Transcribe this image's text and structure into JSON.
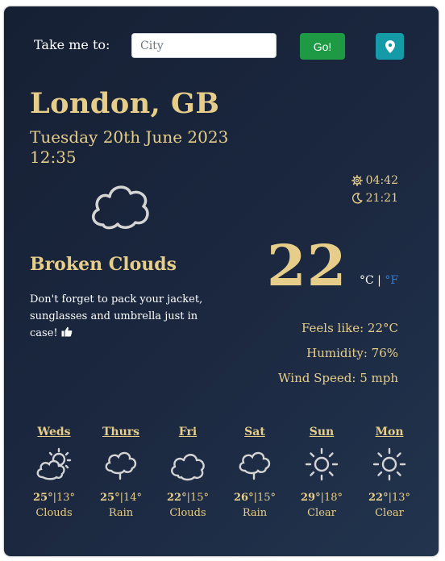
{
  "search": {
    "label": "Take me to:",
    "placeholder": "City",
    "go_label": "Go!"
  },
  "location": {
    "city": "London, GB",
    "date": "Tuesday 20th June 2023",
    "time": "12:35"
  },
  "sun": {
    "sunrise": "04:42",
    "sunset": "21:21"
  },
  "current": {
    "condition": "Broken Clouds",
    "advice": "Don't forget to pack your jacket, sunglasses and umbrella just in case!",
    "temperature": "22",
    "unit_c": "°C",
    "unit_sep": " | ",
    "unit_f": "°F",
    "feels_like": "Feels like: 22°C",
    "humidity": "Humidity: 76%",
    "wind": "Wind Speed: 5 mph",
    "icon": "cloud-icon"
  },
  "forecast": [
    {
      "day": "Weds",
      "high": "25°",
      "low": "13°",
      "desc": "Clouds",
      "icon": "sun-cloud-icon"
    },
    {
      "day": "Thurs",
      "high": "25°",
      "low": "14°",
      "desc": "Rain",
      "icon": "rain-cloud-icon"
    },
    {
      "day": "Fri",
      "high": "22°",
      "low": "15°",
      "desc": "Clouds",
      "icon": "cloud-icon"
    },
    {
      "day": "Sat",
      "high": "26°",
      "low": "15°",
      "desc": "Rain",
      "icon": "rain-cloud-icon"
    },
    {
      "day": "Sun",
      "high": "29°",
      "low": "18°",
      "desc": "Clear",
      "icon": "sun-icon"
    },
    {
      "day": "Mon",
      "high": "22°",
      "low": "13°",
      "desc": "Clear",
      "icon": "sun-icon"
    }
  ],
  "colors": {
    "accent_gold": "#e6cd8a",
    "go_green": "#1e9a45",
    "location_teal": "#159aa8",
    "fahrenheit_blue": "#2d7fd9",
    "card_bg": "#1b2840"
  }
}
